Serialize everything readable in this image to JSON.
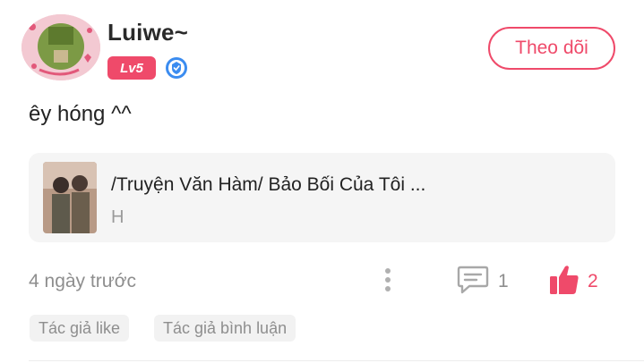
{
  "author": {
    "name": "Luiwe~",
    "level": "Lv5",
    "avatar_icon": "user-avatar",
    "verified_icon": "shield-check-icon"
  },
  "follow_label": "Theo dõi",
  "post": {
    "text": "êy hóng ^^"
  },
  "story": {
    "title": "/Truyện Văn Hàm/ Bảo Bối Của Tôi ...",
    "subtitle": "H"
  },
  "meta": {
    "timestamp": "4 ngày trước",
    "comment_count": "1",
    "like_count": "2"
  },
  "tags": [
    "Tác giả like",
    "Tác giả bình luận"
  ],
  "colors": {
    "accent": "#ef4a6a",
    "muted_text": "#8e8e8e",
    "card_bg": "#f5f5f5"
  }
}
